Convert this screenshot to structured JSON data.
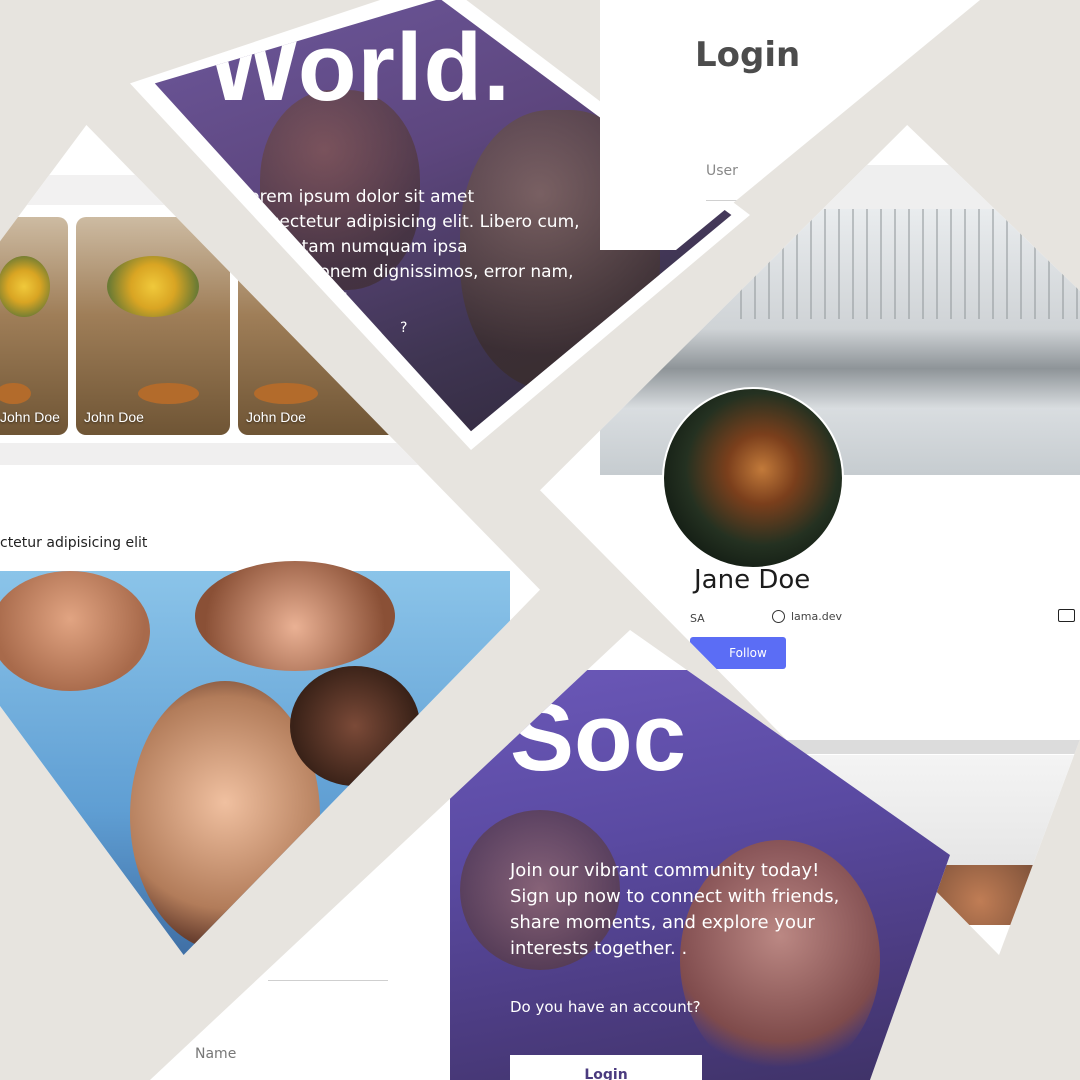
{
  "hero": {
    "title": "World.",
    "text": "Lorem ipsum dolor sit amet consectetur adipisicing elit. Libero cum, alias totam numquam ipsa exercitationem dignissimos, error nam, consequatur.",
    "trailing": "?"
  },
  "login": {
    "title": "Login",
    "username_placeholder": "User"
  },
  "feed": {
    "cards": [
      {
        "label": "John Doe"
      },
      {
        "label": "John Doe"
      },
      {
        "label": "John Doe"
      }
    ],
    "post_text": "ctetur adipisicing elit"
  },
  "profile": {
    "name": "Jane Doe",
    "location": "SA",
    "website": "lama.dev",
    "follow_label": "Follow"
  },
  "register": {
    "title": "Soc",
    "description": "Join our vibrant community today! Sign up now to connect with friends, share moments, and explore your interests together. .",
    "question": "Do you have an account?",
    "login_button": "Login",
    "name_placeholder": "Name"
  },
  "colors": {
    "background": "#e7e4df",
    "accent_blue": "#5b6df5",
    "overlay_purple": "#5d467e"
  }
}
